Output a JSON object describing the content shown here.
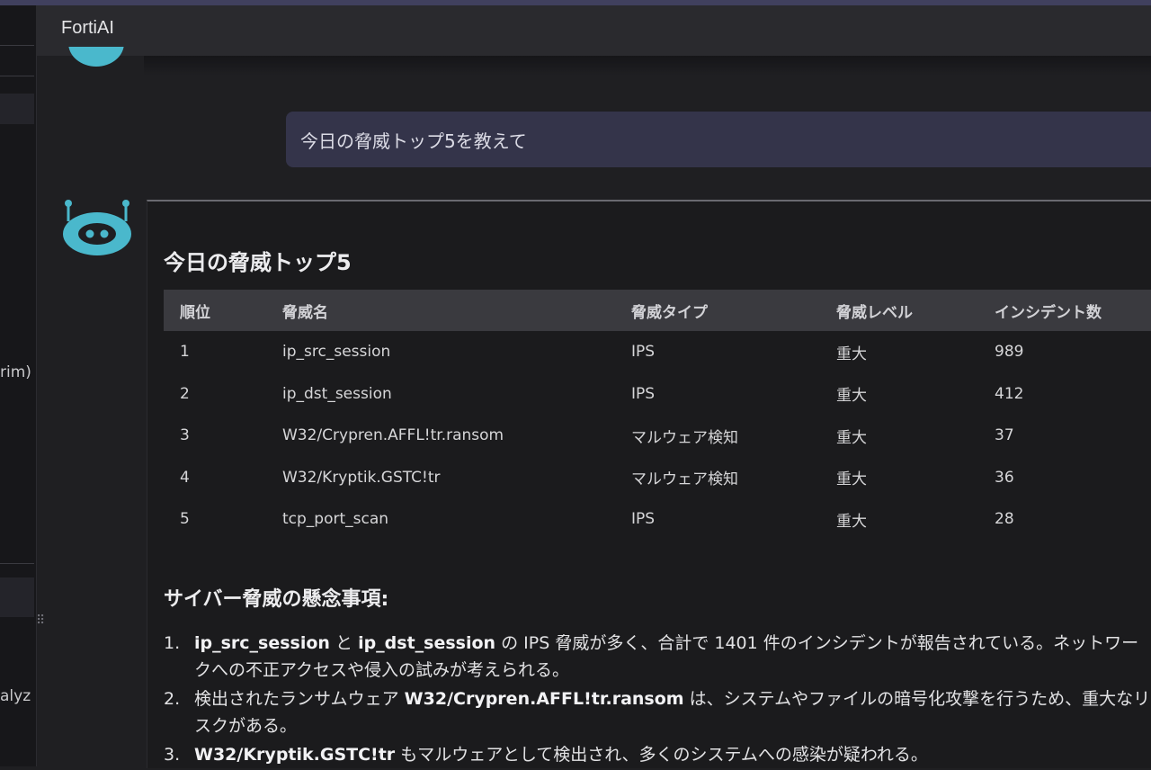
{
  "app": {
    "title": "FortiAI"
  },
  "left_panel": {
    "fragment_1": "rim)",
    "fragment_2": "alyz"
  },
  "chat": {
    "user_message": "今日の脅威トップ5を教えて",
    "response": {
      "title": "今日の脅威トップ5",
      "table": {
        "headers": [
          "順位",
          "脅威名",
          "脅威タイプ",
          "脅威レベル",
          "インシデント数"
        ],
        "rows": [
          [
            "1",
            "ip_src_session",
            "IPS",
            "重大",
            "989"
          ],
          [
            "2",
            "ip_dst_session",
            "IPS",
            "重大",
            "412"
          ],
          [
            "3",
            "W32/Crypren.AFFL!tr.ransom",
            "マルウェア検知",
            "重大",
            "37"
          ],
          [
            "4",
            "W32/Kryptik.GSTC!tr",
            "マルウェア検知",
            "重大",
            "36"
          ],
          [
            "5",
            "tcp_port_scan",
            "IPS",
            "重大",
            "28"
          ]
        ]
      },
      "concerns_title": "サイバー脅威の懸念事項:",
      "concerns": [
        {
          "num": "1.",
          "bold_a": "ip_src_session",
          "text_a": " と ",
          "bold_b": "ip_dst_session",
          "text_b": " の IPS 脅威が多く、合計で 1401 件のインシデントが報告されている。ネットワークへの不正アクセスや侵入の試みが考えられる。"
        },
        {
          "num": "2.",
          "text_a": "検出されたランサムウェア ",
          "bold_a": "W32/Crypren.AFFL!tr.ransom",
          "text_b": " は、システムやファイルの暗号化攻撃を行うため、重大なリスクがある。"
        },
        {
          "num": "3.",
          "bold_a": "W32/Kryptik.GSTC!tr",
          "text_a": " もマルウェアとして検出され、多くのシステムへの感染が疑われる。"
        }
      ]
    }
  },
  "colors": {
    "background": "#1f1f22",
    "header": "#2a2a2e",
    "user_bubble": "#34344a",
    "bot_accent": "#4ab8cc",
    "table_header": "#3a3a3f"
  },
  "icons": {
    "bot": "robot-icon"
  }
}
